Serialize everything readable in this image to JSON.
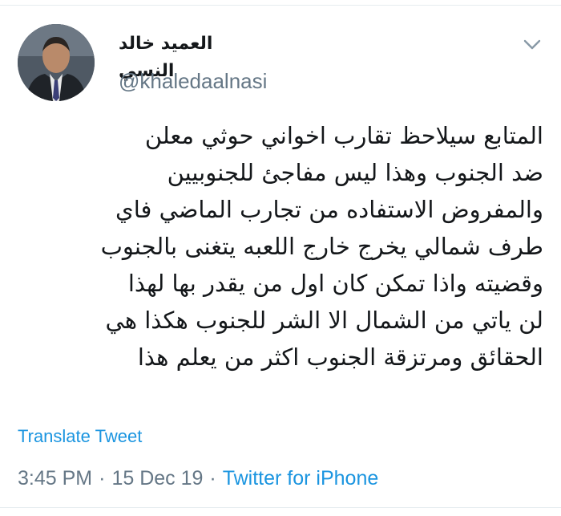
{
  "tweet": {
    "author": {
      "display_name": "العميد خالد النسي",
      "username": "@khaledaalnasi"
    },
    "text_lines": [
      "المتابع سيلاحظ تقارب اخواني حوثي معلن",
      "ضد الجنوب وهذا ليس مفاجئ للجنوبيين",
      "والمفروض الاستفاده من تجارب الماضي فاي",
      "طرف شمالي يخرج خارج اللعبه يتغنى بالجنوب",
      "وقضيته واذا تمكن كان اول من يقدر بها لهذا",
      "لن ياتي من الشمال الا الشر للجنوب هكذا هي",
      "الحقائق ومرتزقة الجنوب اكثر من يعلم هذا"
    ],
    "translate_label": "Translate Tweet",
    "time": "3:45 PM",
    "date": "15 Dec 19",
    "separator": "·",
    "source": "Twitter for iPhone",
    "more_icon": "chevron-down-icon",
    "avatar_icon": "avatar"
  },
  "colors": {
    "link": "#1b95e0",
    "secondary_text": "#657786",
    "primary_text": "#14171a",
    "divider": "#e6ecf0"
  }
}
